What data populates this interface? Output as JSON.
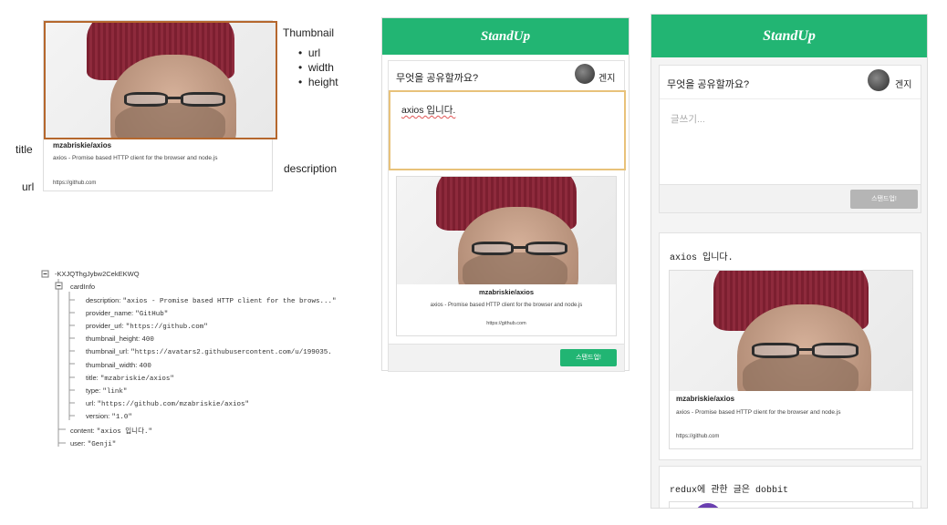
{
  "diagram": {
    "labels": {
      "thumbnail": "Thumbnail",
      "thumb_fields": [
        "url",
        "width",
        "height"
      ],
      "title": "title",
      "url": "url",
      "description": "description"
    },
    "card": {
      "title": "mzabriskie/axios",
      "description": "axios - Promise based HTTP client for the browser and node.js",
      "url": "https://github.com"
    }
  },
  "tree": {
    "root": "-KXJQThgJybw2CekEKWQ",
    "cardinfo": "cardInfo",
    "fields": [
      {
        "k": "description:",
        "v": "\"axios - Promise based HTTP client for the brows...\""
      },
      {
        "k": "provider_name:",
        "v": "\"GitHub\""
      },
      {
        "k": "provider_url:",
        "v": "\"https://github.com\""
      },
      {
        "k": "thumbnail_height:",
        "v": "400"
      },
      {
        "k": "thumbnail_url:",
        "v": "\"https://avatars2.githubusercontent.com/u/199035."
      },
      {
        "k": "thumbnail_width:",
        "v": "400"
      },
      {
        "k": "title:",
        "v": "\"mzabriskie/axios\""
      },
      {
        "k": "type:",
        "v": "\"link\""
      },
      {
        "k": "url:",
        "v": "\"https://github.com/mzabriskie/axios\""
      },
      {
        "k": "version:",
        "v": "\"1.0\""
      }
    ],
    "content": {
      "k": "content:",
      "v": "\"axios 입니다.\""
    },
    "user": {
      "k": "user:",
      "v": "\"Genji\""
    }
  },
  "app1": {
    "header": "StandUp",
    "prompt": "무엇을 공유할까요?",
    "username": "겐지",
    "input_value": "axios 입니다.",
    "card": {
      "title": "mzabriskie/axios",
      "description": "axios - Promise based HTTP client for the browser and node.js",
      "url": "https://github.com"
    },
    "submit": "스탠드업!"
  },
  "app2": {
    "header": "StandUp",
    "prompt": "무엇을 공유할까요?",
    "username": "겐지",
    "placeholder": "글쓰기...",
    "submit": "스탠드업!",
    "post1": {
      "content": "axios 입니다.",
      "card": {
        "title": "mzabriskie/axios",
        "description": "axios - Promise based HTTP client for the browser and node.js",
        "url": "https://github.com"
      }
    },
    "post2": {
      "content": "redux에 관한 글은 dobbit"
    }
  },
  "colors": {
    "accent": "#22b573",
    "highlight_border": "#b5672d",
    "focus_border": "#e8c27a"
  }
}
